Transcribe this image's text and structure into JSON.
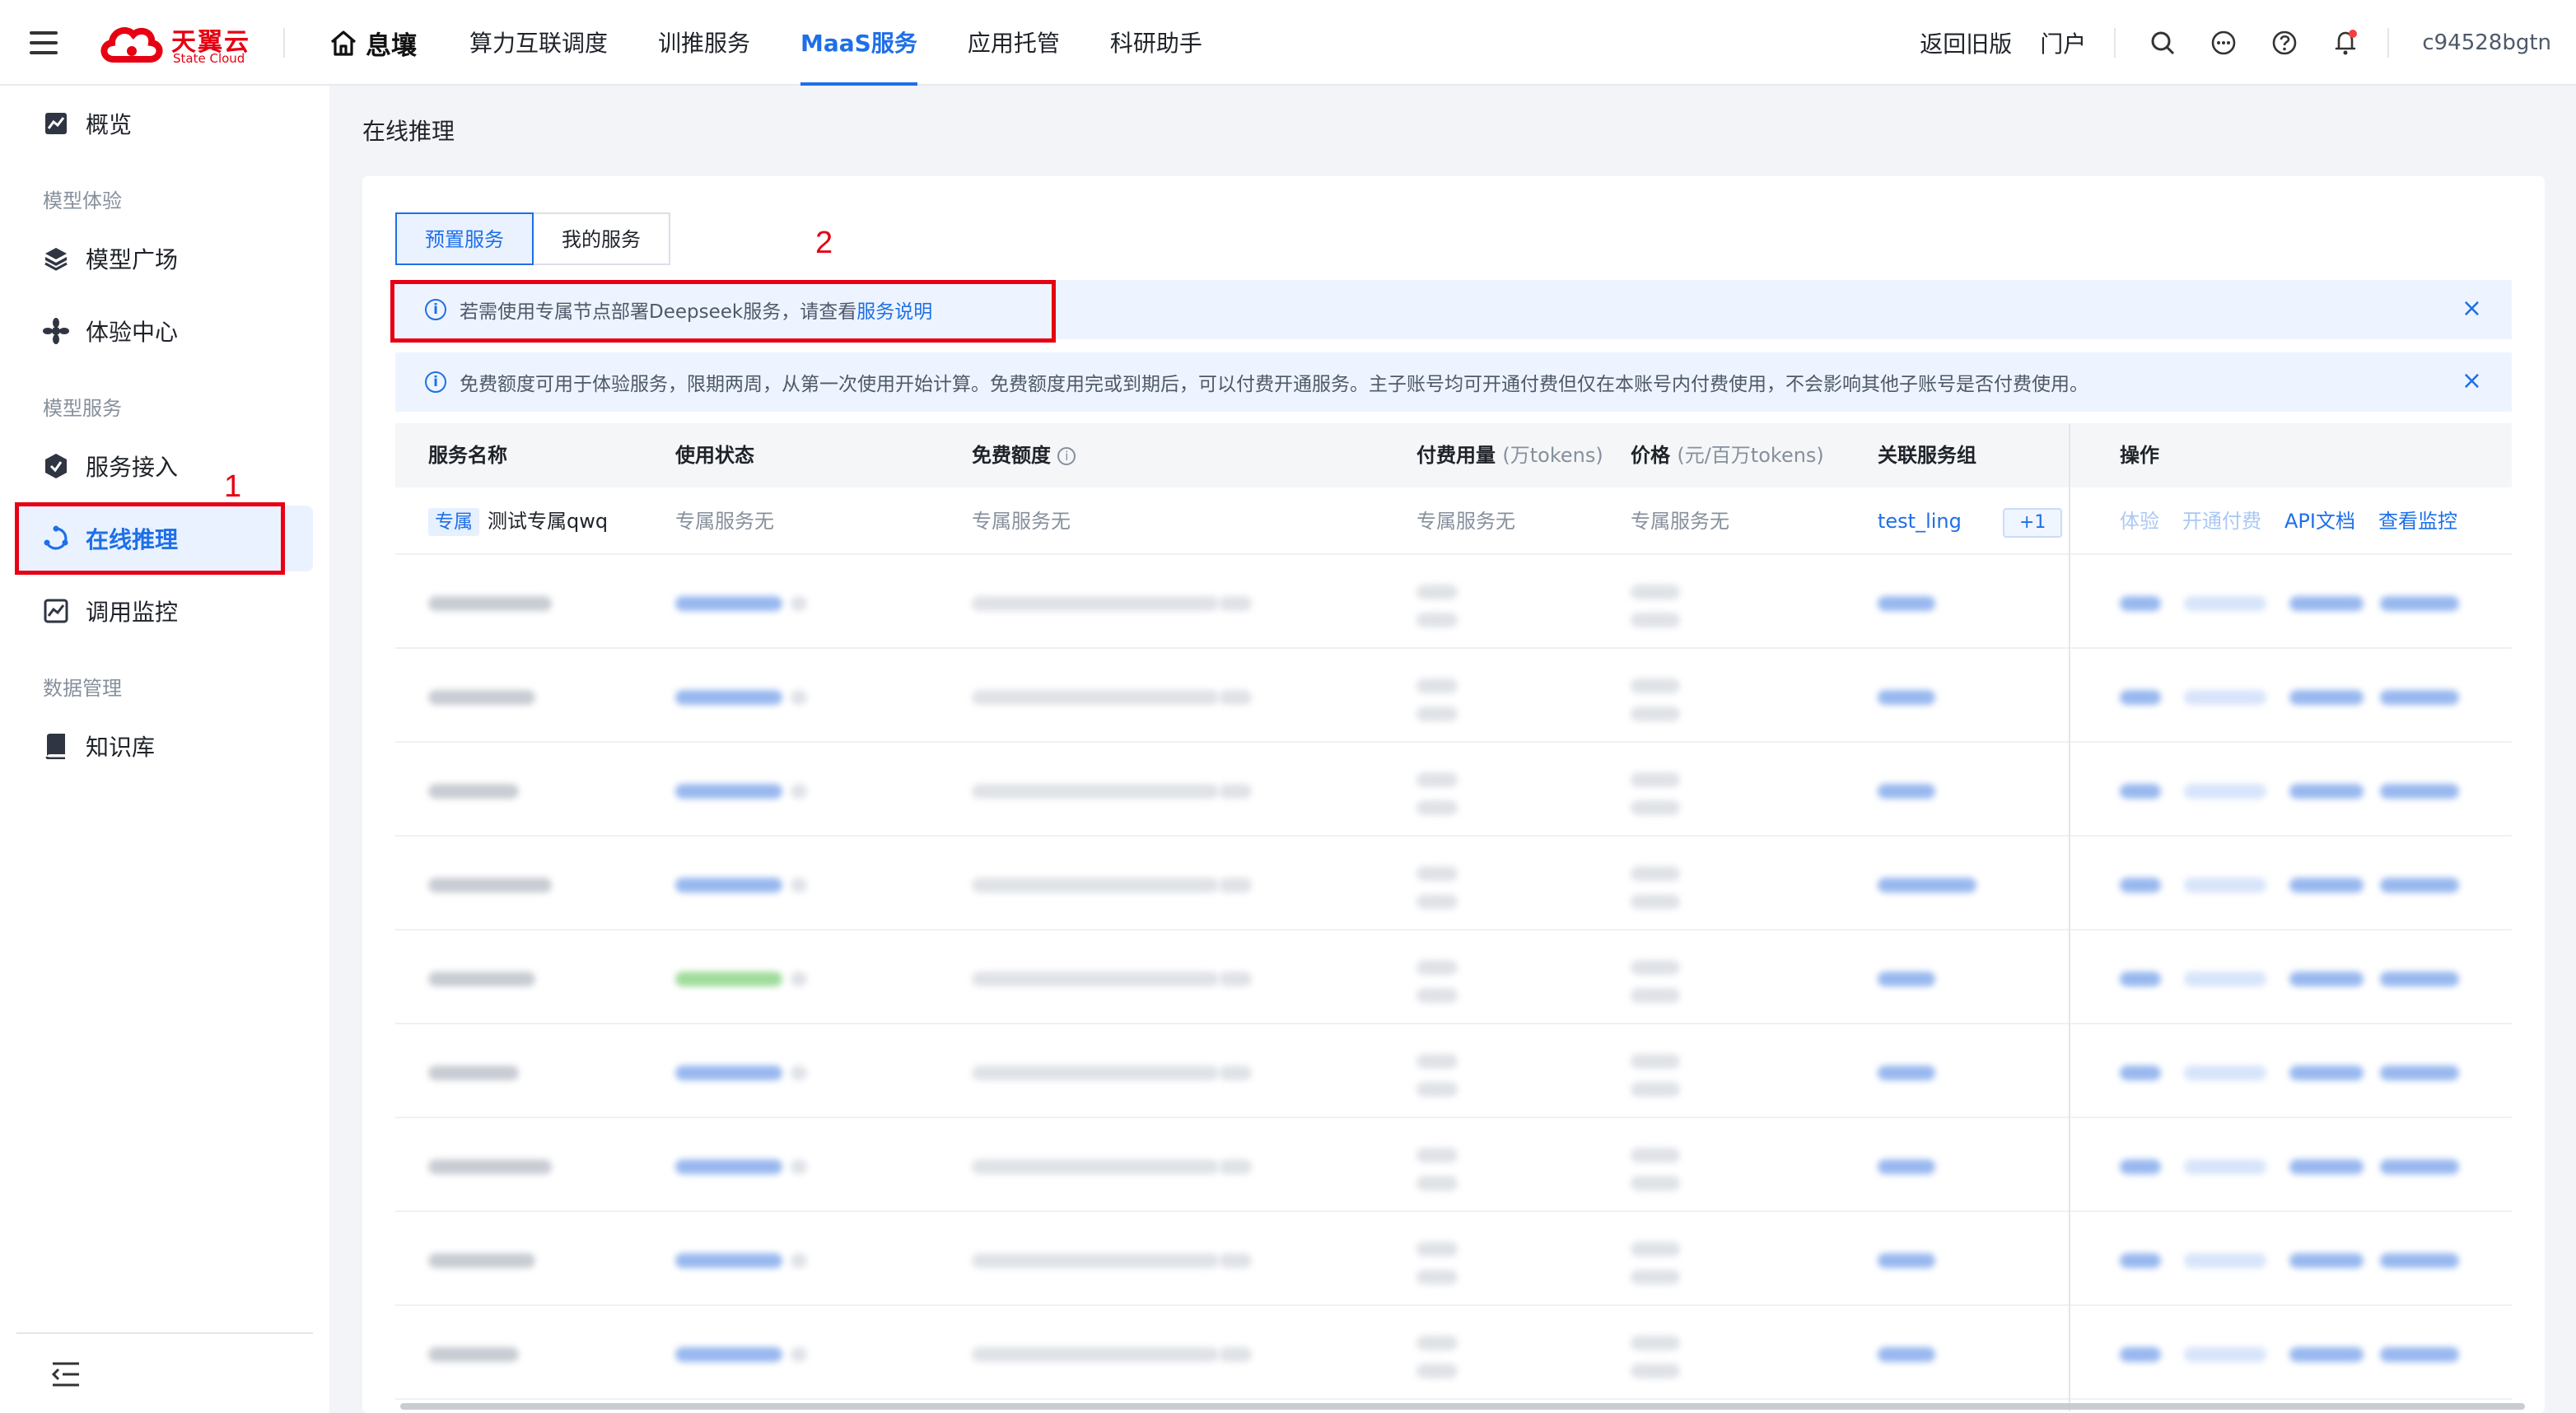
{
  "header": {
    "logo_cn": "天翼云",
    "logo_en": "State Cloud",
    "brand": "息壤",
    "nav": [
      "算力互联调度",
      "训推服务",
      "MaaS服务",
      "应用托管",
      "科研助手"
    ],
    "active_nav": "MaaS服务",
    "back_old": "返回旧版",
    "portal": "门户",
    "user": "c94528bgtn"
  },
  "sidebar": {
    "overview": "概览",
    "group1": "模型体验",
    "model_square": "模型广场",
    "experience_center": "体验中心",
    "group2": "模型服务",
    "service_access": "服务接入",
    "online_inference": "在线推理",
    "call_monitor": "调用监控",
    "group3": "数据管理",
    "knowledge_base": "知识库"
  },
  "annotations": {
    "one": "1",
    "two": "2"
  },
  "main": {
    "page_title": "在线推理",
    "tabs": [
      "预置服务",
      "我的服务"
    ],
    "notice1_text": "若需使用专属节点部署Deepseek服务，请查看",
    "notice1_link": "服务说明",
    "notice2_text": "免费额度可用于体验服务，限期两周，从第一次使用开始计算。免费额度用完或到期后，可以付费开通服务。主子账号均可开通付费但仅在本账号内付费使用，不会影响其他子账号是否付费使用。",
    "columns": {
      "name": "服务名称",
      "status": "使用状态",
      "free_quota": "免费额度",
      "paid_usage": "付费用量",
      "paid_usage_unit": "(万tokens)",
      "price": "价格",
      "price_unit": "(元/百万tokens)",
      "group": "关联服务组",
      "ops": "操作"
    },
    "first_row": {
      "tag": "专属",
      "name": "测试专属qwq",
      "status": "专属服务无",
      "free_quota": "专属服务无",
      "paid_usage": "专属服务无",
      "price": "专属服务无",
      "group": "test_ling",
      "group_more": "+1",
      "ops": [
        "体验",
        "开通付费",
        "API文档",
        "查看监控"
      ]
    }
  },
  "colors": {
    "accent": "#1e6fe8",
    "annotation": "#e60012"
  }
}
